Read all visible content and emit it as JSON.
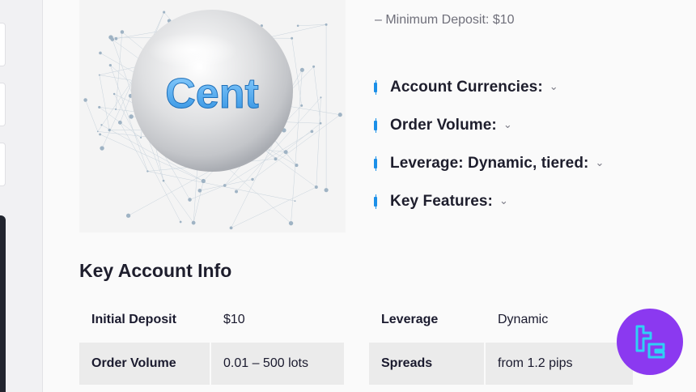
{
  "hero": {
    "image_text": "Cent"
  },
  "min_deposit_text": "– Minimum Deposit: $10",
  "features": [
    {
      "label": "Account Currencies:"
    },
    {
      "label": "Order Volume:"
    },
    {
      "label": "Leverage: Dynamic, tiered:"
    },
    {
      "label": "Key Features:"
    }
  ],
  "section_title": "Key Account Info",
  "table": {
    "rows": [
      {
        "k1": "Initial Deposit",
        "v1": "$10",
        "k2": "Leverage",
        "v2": "Dynamic"
      },
      {
        "k1": "Order Volume",
        "v1": "0.01 – 500 lots",
        "k2": "Spreads",
        "v2": "from 1.2 pips"
      }
    ]
  },
  "colors": {
    "accent_blue": "#1b8fe8",
    "badge_purple": "#8b39f0",
    "row_shade": "#ebebeb"
  },
  "icons": {
    "chevron": "chevron-down-icon",
    "bullet": "candlestick-bullet-icon",
    "badge": "tradingfinder-logo-icon"
  }
}
